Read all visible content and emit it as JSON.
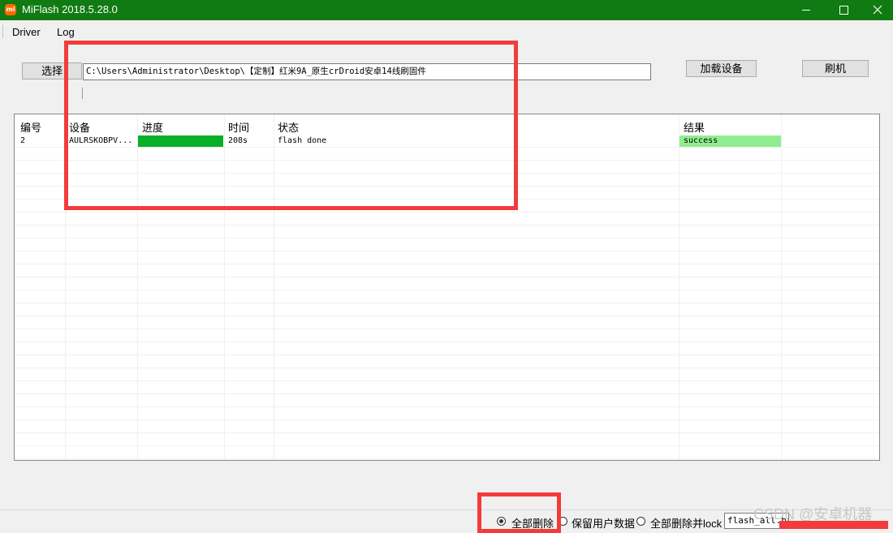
{
  "window": {
    "icon_text": "mi",
    "title": "MiFlash 2018.5.28.0",
    "controls": [
      "—",
      "☐",
      "✕"
    ]
  },
  "menu": {
    "items": [
      "Driver",
      "Log"
    ]
  },
  "toolbar": {
    "select_label": "选择",
    "path_value": "C:\\Users\\Administrator\\Desktop\\【定制】红米9A_原生crDroid安卓14线刷固件",
    "load_device_label": "加载设备",
    "flash_label": "刷机"
  },
  "table": {
    "headers": [
      "编号",
      "设备",
      "进度",
      "时间",
      "状态",
      "结果"
    ],
    "rows": [
      {
        "id": "2",
        "device": "AULRSKOBPV...",
        "progress": 1.0,
        "time": "208s",
        "status": "flash done",
        "result": "success"
      }
    ]
  },
  "bottom": {
    "options": [
      {
        "label": "全部删除",
        "selected": true
      },
      {
        "label": "保留用户数据",
        "selected": false
      },
      {
        "label": "全部删除并lock",
        "selected": false
      }
    ],
    "script_value": "flash_all.bat"
  },
  "watermark": "CSDN @安卓机器",
  "colors": {
    "titlebar": "#0f7b12",
    "progress_fill": "#08b028",
    "success_fill": "#90ee90",
    "annotation_red": "#f33b3b"
  }
}
